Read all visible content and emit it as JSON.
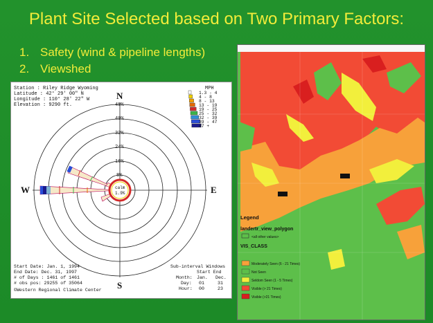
{
  "slide": {
    "title": "Plant Site Selected based on Two Primary Factors:",
    "bullets": [
      {
        "num": "1.",
        "text": "Safety (wind & pipeline lengths)"
      },
      {
        "num": "2.",
        "text": "Viewshed"
      }
    ]
  },
  "wind_rose": {
    "station_lines": [
      "Station   : Riley Ridge Wyoming",
      "Latitude  : 42° 29' 00\" N",
      "Longitude : 110° 28' 22\" W",
      "Elevation : 9290 ft."
    ],
    "compass": {
      "n": "N",
      "s": "S",
      "e": "E",
      "w": "W"
    },
    "ring_labels": [
      "48%",
      "40%",
      "32%",
      "24%",
      "16%",
      "8%"
    ],
    "calm_label": "calm",
    "calm_value": "1.9%",
    "legend_title": "MPH",
    "legend_items": [
      "1.3 - 4",
      "4 - 8",
      "8 - 13",
      "13 - 19",
      "19 - 25",
      "25 - 32",
      "32 - 39",
      "39 - 47",
      "47 +"
    ],
    "legend_colors": [
      "#ffffff",
      "#f2d200",
      "#f4a000",
      "#e56b00",
      "#d32a2a",
      "#3cb44b",
      "#2f8fd8",
      "#2a4dd8",
      "#1a1a8c"
    ],
    "footer_lines": [
      "Start Date: Jan. 1, 1994",
      "  End Date: Dec. 31, 1997",
      "# of Days : 1461 of 1461",
      "# obs pos: 29255 of 35064",
      "©Western Regional Climate Center"
    ],
    "subint": {
      "title": "Sub-interval Windows",
      "head": "Start   End",
      "rows": [
        {
          "k": "Month:",
          "a": "Jan.",
          "b": "Dec."
        },
        {
          "k": "Day:",
          "a": "01",
          "b": "31"
        },
        {
          "k": "Hour:",
          "a": "00",
          "b": "23"
        }
      ]
    }
  },
  "viewshed_map": {
    "legend_title": "Legend",
    "layer": "landertr_view_polygon",
    "other_values": "<all other values>",
    "class_title": "VIS_CLASS",
    "classes": [
      {
        "label": "Moderately Seen (6 - 21 Times)",
        "color": "#f7a13a"
      },
      {
        "label": "Not Seen",
        "color": "#5dbf4a"
      },
      {
        "label": "Seldom Seen (1 - 5 Times)",
        "color": "#f2ef3c"
      },
      {
        "label": "Visible (> 21 Times)",
        "color": "#f24b35"
      },
      {
        "label": "Visible (>21 Times)",
        "color": "#d91f1f"
      }
    ]
  }
}
